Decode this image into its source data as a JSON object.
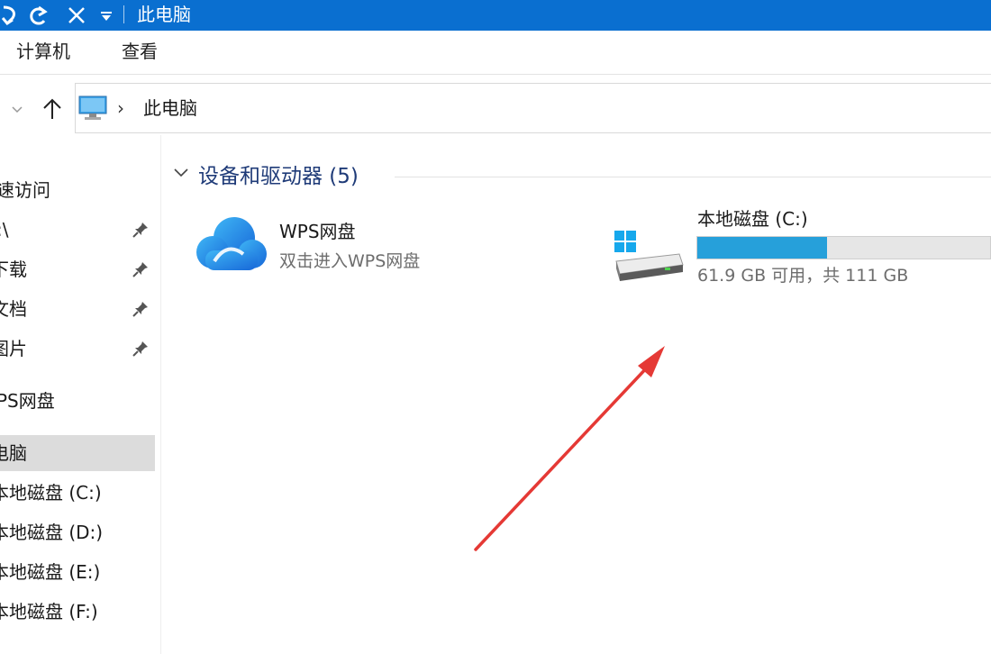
{
  "window": {
    "title": "此电脑"
  },
  "ribbon": {
    "tabs": [
      {
        "label": "计算机"
      },
      {
        "label": "查看"
      }
    ]
  },
  "address": {
    "location": "此电脑"
  },
  "sidebar": {
    "items": [
      {
        "label": "速访问",
        "pinned": false,
        "selected": false
      },
      {
        "label": ":\\",
        "pinned": true,
        "selected": false
      },
      {
        "label": "下载",
        "pinned": true,
        "selected": false
      },
      {
        "label": "文档",
        "pinned": true,
        "selected": false
      },
      {
        "label": "图片",
        "pinned": true,
        "selected": false
      },
      {
        "label": "PS网盘",
        "pinned": false,
        "selected": false
      },
      {
        "label": "电脑",
        "pinned": false,
        "selected": true
      },
      {
        "label": "本地磁盘 (C:)",
        "pinned": false,
        "selected": false
      },
      {
        "label": "本地磁盘 (D:)",
        "pinned": false,
        "selected": false
      },
      {
        "label": "本地磁盘 (E:)",
        "pinned": false,
        "selected": false
      },
      {
        "label": "本地磁盘 (F:)",
        "pinned": false,
        "selected": false
      }
    ]
  },
  "main": {
    "group": {
      "title": "设备和驱动器 (5)"
    },
    "tiles": [
      {
        "name": "WPS网盘",
        "subtitle": "双击进入WPS网盘",
        "icon": "cloud-icon"
      },
      {
        "name": "本地磁盘 (C:)",
        "subtitle": "61.9 GB 可用，共 111 GB",
        "icon": "windows-drive-icon",
        "usage_fraction": 0.442
      }
    ]
  },
  "colors": {
    "titlebar": "#0a6fd0",
    "drive_fill": "#26a0da",
    "annotation_arrow": "#e53935",
    "group_title": "#1f3b78"
  }
}
